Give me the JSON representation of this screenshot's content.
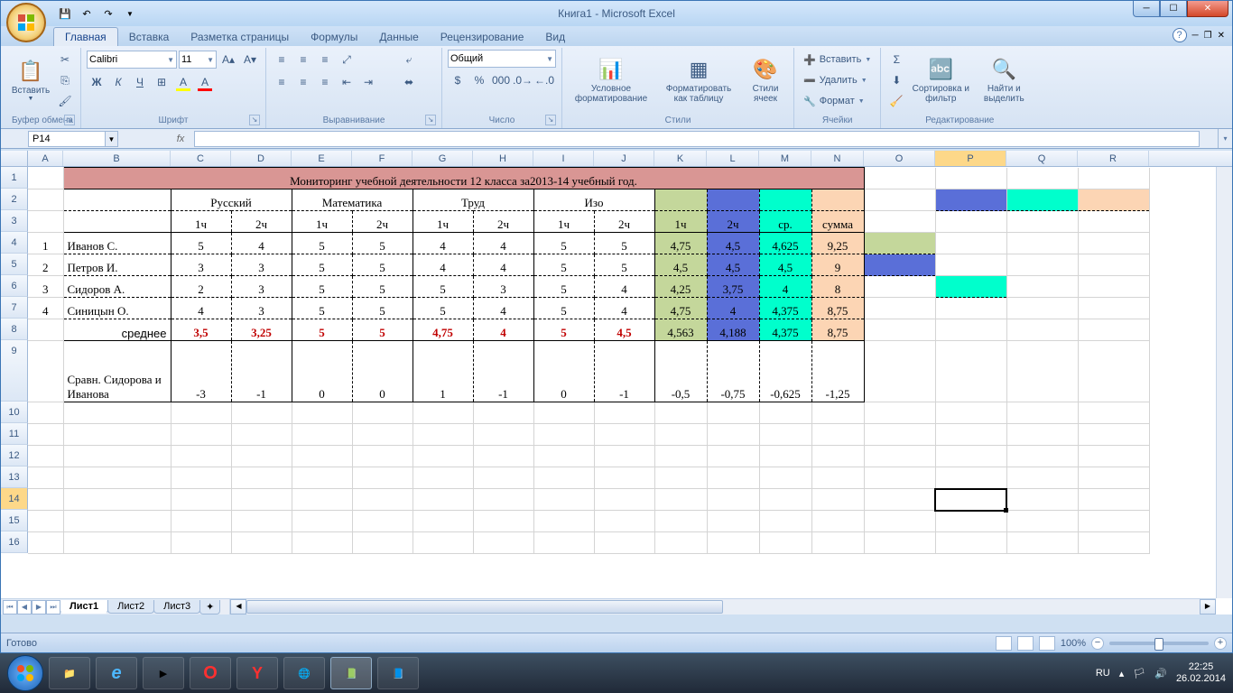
{
  "window": {
    "title": "Книга1 - Microsoft Excel"
  },
  "qat": {
    "save": "💾"
  },
  "tabs": [
    "Главная",
    "Вставка",
    "Разметка страницы",
    "Формулы",
    "Данные",
    "Рецензирование",
    "Вид"
  ],
  "ribbon": {
    "clipboard": {
      "paste": "Вставить",
      "label": "Буфер обмена"
    },
    "font": {
      "name": "Calibri",
      "size": "11",
      "label": "Шрифт"
    },
    "align": {
      "label": "Выравнивание"
    },
    "number": {
      "format": "Общий",
      "label": "Число"
    },
    "styles": {
      "cond": "Условное форматирование",
      "table": "Форматировать как таблицу",
      "cell": "Стили ячеек",
      "label": "Стили"
    },
    "cells": {
      "insert": "Вставить",
      "delete": "Удалить",
      "format": "Формат",
      "label": "Ячейки"
    },
    "editing": {
      "sort": "Сортировка и фильтр",
      "find": "Найти и выделить",
      "label": "Редактирование"
    }
  },
  "namebox": "P14",
  "columns": [
    "A",
    "B",
    "C",
    "D",
    "E",
    "F",
    "G",
    "H",
    "I",
    "J",
    "K",
    "L",
    "M",
    "N",
    "O",
    "P",
    "Q",
    "R"
  ],
  "rows": [
    "1",
    "2",
    "3",
    "4",
    "5",
    "6",
    "7",
    "8",
    "9",
    "10",
    "11",
    "12",
    "13",
    "14",
    "15",
    "16"
  ],
  "sheet": {
    "title": "Мониторинг учебной деятельности 12 класса за2013-14 учебный год.",
    "subjects": [
      "Русский",
      "Математика",
      "Труд",
      "Изо"
    ],
    "periods": [
      "1ч",
      "2ч",
      "1ч",
      "2ч",
      "1ч",
      "2ч",
      "1ч",
      "2ч",
      "1ч",
      "2ч",
      "ср.",
      "сумма"
    ],
    "rows": [
      {
        "n": "1",
        "name": "Иванов С.",
        "v": [
          "5",
          "4",
          "5",
          "5",
          "4",
          "4",
          "5",
          "5",
          "4,75",
          "4,5",
          "4,625",
          "9,25"
        ]
      },
      {
        "n": "2",
        "name": "Петров И.",
        "v": [
          "3",
          "3",
          "5",
          "5",
          "4",
          "4",
          "5",
          "5",
          "4,5",
          "4,5",
          "4,5",
          "9"
        ]
      },
      {
        "n": "3",
        "name": "Сидоров А.",
        "v": [
          "2",
          "3",
          "5",
          "5",
          "5",
          "3",
          "5",
          "4",
          "4,25",
          "3,75",
          "4",
          "8"
        ]
      },
      {
        "n": "4",
        "name": "Синицын О.",
        "v": [
          "4",
          "3",
          "5",
          "5",
          "5",
          "4",
          "5",
          "4",
          "4,75",
          "4",
          "4,375",
          "8,75"
        ]
      }
    ],
    "avg": {
      "label": "среднее",
      "v": [
        "3,5",
        "3,25",
        "5",
        "5",
        "4,75",
        "4",
        "5",
        "4,5",
        "4,563",
        "4,188",
        "4,375",
        "8,75"
      ]
    },
    "cmp": {
      "label": "Сравн. Сидорова и Иванова",
      "v": [
        "-3",
        "-1",
        "0",
        "0",
        "1",
        "-1",
        "0",
        "-1",
        "-0,5",
        "-0,75",
        "-0,625",
        "-1,25"
      ]
    }
  },
  "sheettabs": [
    "Лист1",
    "Лист2",
    "Лист3"
  ],
  "status": {
    "ready": "Готово",
    "zoom": "100%"
  },
  "taskbar": {
    "lang": "RU",
    "time": "22:25",
    "date": "26.02.2014"
  }
}
